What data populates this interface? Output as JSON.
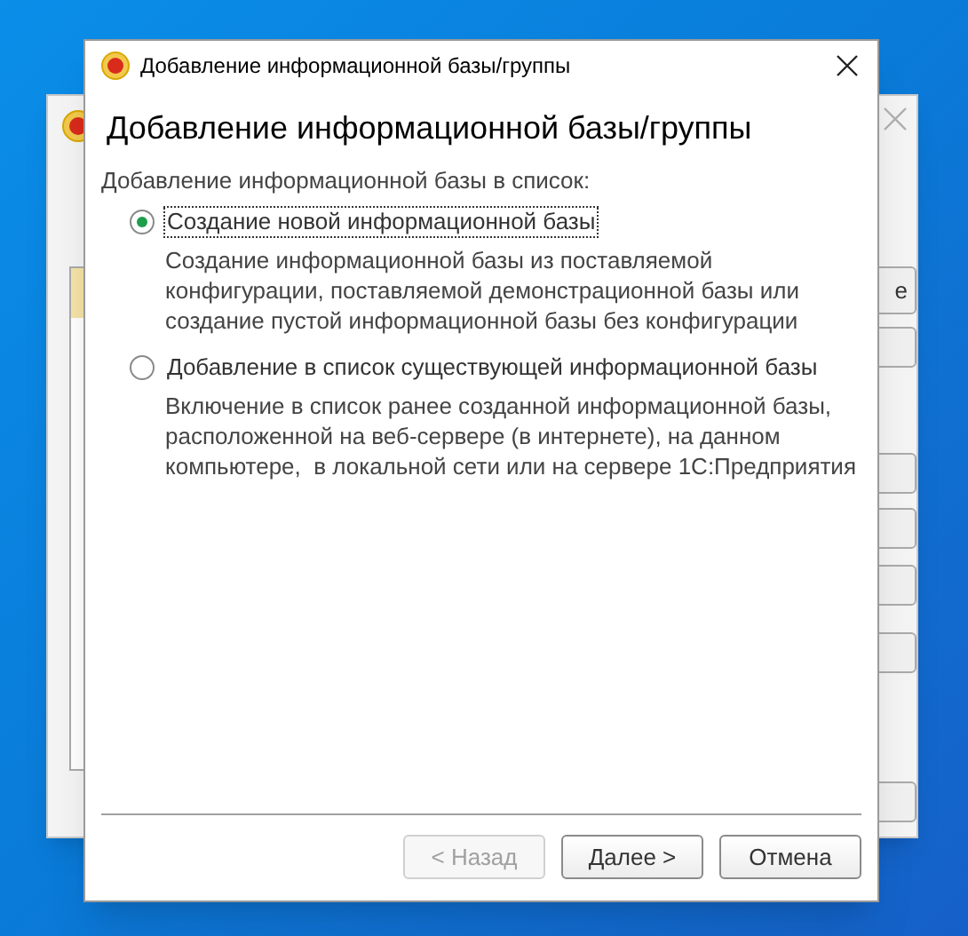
{
  "background_window": {
    "button_fragment": "е"
  },
  "dialog": {
    "title": "Добавление информационной базы/группы",
    "heading": "Добавление информационной базы/группы",
    "section_label": "Добавление информационной базы в список:",
    "options": [
      {
        "label": "Создание новой информационной базы",
        "selected": true,
        "description_lines": [
          "Создание информационной базы из поставляемой",
          "конфигурации, поставляемой демонстрационной базы или",
          "создание пустой информационной базы без конфигурации"
        ]
      },
      {
        "label": "Добавление в список существующей информационной базы",
        "selected": false,
        "description_lines": [
          "Включение в список ранее созданной информационной базы,",
          "расположенной на веб-сервере (в интернете), на данном",
          "компьютере,  в локальной сети или на сервере 1С:Предприятия"
        ]
      }
    ],
    "buttons": [
      {
        "label": "< Назад",
        "disabled": true
      },
      {
        "label": "Далее >",
        "disabled": false
      },
      {
        "label": "Отмена",
        "disabled": false
      }
    ]
  }
}
